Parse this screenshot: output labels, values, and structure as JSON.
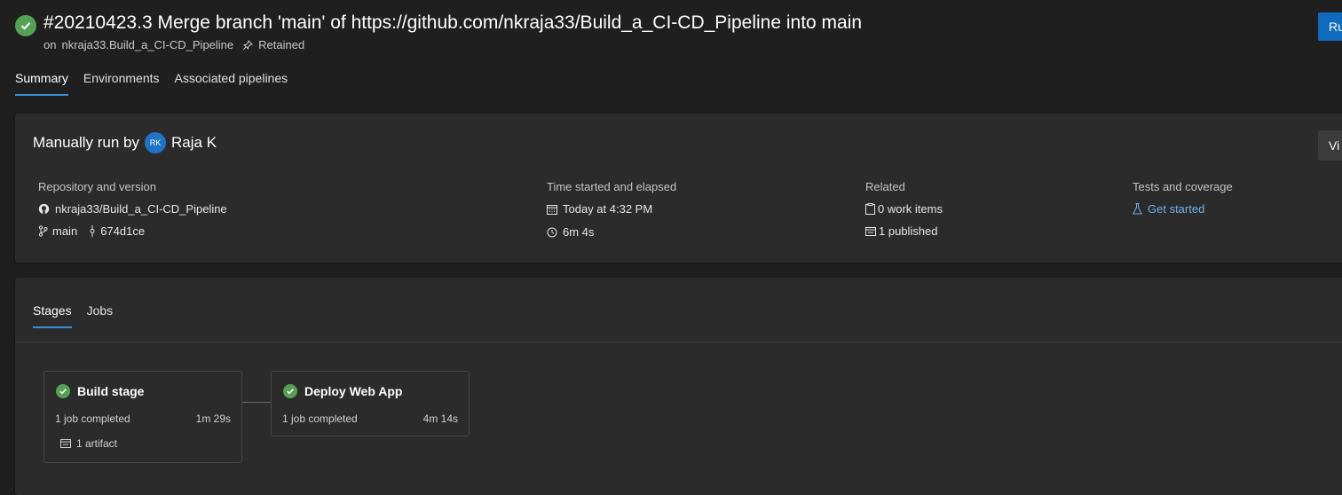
{
  "header": {
    "title": "#20210423.3 Merge branch 'main' of https://github.com/nkraja33/Build_a_CI-CD_Pipeline into main",
    "subtitle_prefix": "on",
    "pipeline": "nkraja33.Build_a_CI-CD_Pipeline",
    "retained": "Retained",
    "run_button": "Ru"
  },
  "tabs": [
    "Summary",
    "Environments",
    "Associated pipelines"
  ],
  "summary": {
    "run_by_label": "Manually run by",
    "avatar_initials": "RK",
    "user": "Raja K",
    "view_button": "Vi",
    "repo": {
      "label": "Repository and version",
      "name": "nkraja33/Build_a_CI-CD_Pipeline",
      "branch": "main",
      "commit": "674d1ce"
    },
    "time": {
      "label": "Time started and elapsed",
      "started": "Today at 4:32 PM",
      "elapsed": "6m 4s"
    },
    "related": {
      "label": "Related",
      "work_items": "0 work items",
      "published": "1 published"
    },
    "tests": {
      "label": "Tests and coverage",
      "link": "Get started"
    }
  },
  "stage_tabs": [
    "Stages",
    "Jobs"
  ],
  "stages": [
    {
      "name": "Build stage",
      "jobs": "1 job completed",
      "duration": "1m 29s",
      "artifact": "1 artifact"
    },
    {
      "name": "Deploy Web App",
      "jobs": "1 job completed",
      "duration": "4m 14s"
    }
  ],
  "colors": {
    "success": "#54a054",
    "accent": "#0f6cbd",
    "link": "#6cb0ef",
    "avatar": "#1e73c8"
  }
}
